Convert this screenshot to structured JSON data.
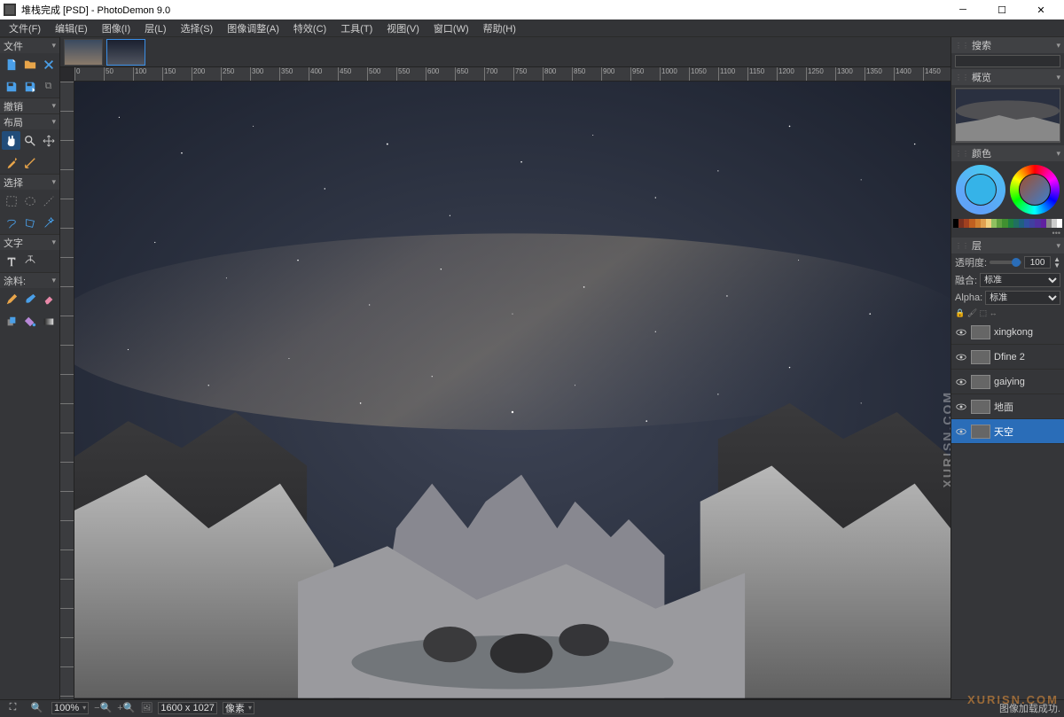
{
  "window": {
    "title": "堆栈完成 [PSD]  -  PhotoDemon 9.0"
  },
  "menu": {
    "file": "文件(F)",
    "edit": "编辑(E)",
    "image": "图像(I)",
    "layer": "层(L)",
    "select": "选择(S)",
    "adjust": "图像调整(A)",
    "effects": "特效(C)",
    "tools": "工具(T)",
    "view": "视图(V)",
    "window": "窗口(W)",
    "help": "帮助(H)"
  },
  "sections": {
    "file": "文件",
    "undo": "撤销",
    "layout": "布局",
    "select": "选择",
    "text": "文字",
    "paint": "涂料:"
  },
  "rulerTicks": [
    "0",
    "50",
    "100",
    "150",
    "200",
    "250",
    "300",
    "350",
    "400",
    "450",
    "500",
    "550",
    "600",
    "650",
    "700",
    "750",
    "800",
    "850",
    "900",
    "950",
    "1000",
    "1050",
    "1100",
    "1150",
    "1200",
    "1250",
    "1300",
    "1350",
    "1400",
    "1450"
  ],
  "panels": {
    "search": "搜索",
    "overview": "概览",
    "color": "颜色",
    "layers": "层"
  },
  "layerPanel": {
    "opacity_label": "透明度:",
    "opacity_value": "100",
    "blend_label": "融合:",
    "blend_value": "标准",
    "alpha_label": "Alpha:",
    "alpha_value": "标准"
  },
  "layers": [
    {
      "name": "xingkong",
      "selected": false
    },
    {
      "name": "Dfine 2",
      "selected": false
    },
    {
      "name": "gaiying",
      "selected": false
    },
    {
      "name": "地面",
      "selected": false
    },
    {
      "name": "天空",
      "selected": true
    }
  ],
  "swatches": [
    "#000",
    "#7a3020",
    "#a04020",
    "#c06020",
    "#d08030",
    "#e0a050",
    "#f0d080",
    "#90c060",
    "#60a040",
    "#409030",
    "#208040",
    "#207060",
    "#206080",
    "#3050a0",
    "#4040a0",
    "#5030a0",
    "#6020a0",
    "#888",
    "#ccc",
    "#fff"
  ],
  "status": {
    "zoom": "100%",
    "dims": "1600 x 1027",
    "units": "像素",
    "message": "图像加载成功."
  },
  "watermark": "XURISN.COM",
  "watermark2": "XURISN.COM"
}
